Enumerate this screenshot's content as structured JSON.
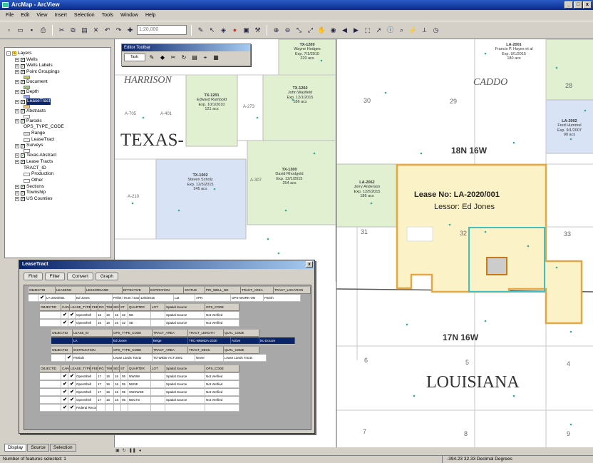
{
  "window": {
    "title": "ArcMap - ArcView"
  },
  "menu": [
    "File",
    "Edit",
    "View",
    "Insert",
    "Selection",
    "Tools",
    "Window",
    "Help"
  ],
  "toolbar": {
    "scale_placeholder": "1:20,000"
  },
  "toc": {
    "items": [
      {
        "label": "Layers",
        "level": 0,
        "pm": "−",
        "cb": false,
        "icon": "layers"
      },
      {
        "label": "Wells",
        "level": 1,
        "pm": "+",
        "cb": true
      },
      {
        "label": "Wells Labels",
        "level": 1,
        "pm": "+",
        "cb": true
      },
      {
        "label": "Point Groupings",
        "level": 1,
        "pm": "+",
        "cb": true
      },
      {
        "label": "",
        "level": 2,
        "swatch": "#cc4"
      },
      {
        "label": "Document",
        "level": 1,
        "pm": "+",
        "cb": true
      },
      {
        "label": "",
        "level": 2,
        "swatch": "#9c6"
      },
      {
        "label": "Depth",
        "level": 1,
        "pm": "+",
        "cb": true
      },
      {
        "label": "",
        "level": 2,
        "swatch": "#9ae"
      },
      {
        "label": "LeaseTract",
        "level": 1,
        "pm": "+",
        "cb": true,
        "selected": true
      },
      {
        "label": "",
        "level": 2,
        "swatch": "#ec8"
      },
      {
        "label": "Abstracts",
        "level": 1,
        "pm": "+",
        "cb": true
      },
      {
        "label": "",
        "level": 2,
        "swatch": "#fff"
      },
      {
        "label": "Parcels",
        "level": 1,
        "pm": "+",
        "cb": true
      },
      {
        "label": "OPS_TYPE_CODE",
        "level": 2
      },
      {
        "label": "Range",
        "level": 2,
        "swatch": "#ddd"
      },
      {
        "label": "LeaseTract",
        "level": 2,
        "swatch": "#eee"
      },
      {
        "label": "Surveys",
        "level": 1,
        "pm": "+",
        "cb": true
      },
      {
        "label": "",
        "level": 2,
        "swatch": "#fff"
      },
      {
        "label": "",
        "level": 2
      },
      {
        "label": "Texas Abstract",
        "level": 1,
        "pm": "+",
        "cb": true
      },
      {
        "label": "Lease Tracts",
        "level": 1,
        "pm": "+",
        "cb": true
      },
      {
        "label": "TRACT_ID",
        "level": 2
      },
      {
        "label": "Production",
        "level": 2,
        "swatch": "#fff"
      },
      {
        "label": "Other",
        "level": 2,
        "swatch": "#fff"
      },
      {
        "label": "Sections",
        "level": 1,
        "pm": "+",
        "cb": true
      },
      {
        "label": "Township",
        "level": 1,
        "pm": "+",
        "cb": true
      },
      {
        "label": "US Counties",
        "level": 1,
        "pm": "+",
        "cb": true
      }
    ],
    "tabs": [
      "Display",
      "Source",
      "Selection"
    ]
  },
  "editor_toolbar": {
    "title": "Editor Toolbar",
    "dropdown": "Task:"
  },
  "map": {
    "county_harrison": "HARRISON",
    "state_texas": "TEXAS-",
    "county_caddo": "CADDO",
    "state_louisiana": "LOUISIANA",
    "township_north": "18N 16W",
    "township_south": "17N 16W",
    "lease_no": "Lease No: LA-2020/001",
    "lessor": "Lessor: Ed Jones",
    "sections": {
      "s30": "30",
      "s29": "29",
      "s28": "28",
      "s31": "31",
      "s32": "32",
      "s33": "33",
      "s6": "6",
      "s5": "5",
      "s4": "4",
      "s7": "7",
      "s8": "8",
      "s9": "9"
    },
    "abstracts": {
      "a1": "A-705",
      "a2": "A-401",
      "a3": "A-273",
      "a4": "A-210",
      "a5": "A-307"
    },
    "tracts": [
      {
        "id": "TX-1200",
        "name": "Wayne Hodges",
        "exp": "Exp. 7/1/2010",
        "acres": "220 acs"
      },
      {
        "id": "TX-1201",
        "name": "Edward Rumbold",
        "exp": "Exp. 10/1/2010",
        "acres": "121 acs"
      },
      {
        "id": "TX-1202",
        "name": "John Wayfield",
        "exp": "Exp. 12/1/2015",
        "acres": "186 acs"
      },
      {
        "id": "TX-1002",
        "name": "Steven Scholz",
        "exp": "Exp. 12/5/2015",
        "acres": "245 acs"
      },
      {
        "id": "TX-1300",
        "name": "David Rhodgold",
        "exp": "Exp. 12/1/2015",
        "acres": "254 acs"
      },
      {
        "id": "LA-2062",
        "name": "Jerry Anderson",
        "exp": "Exp. 12/5/2015",
        "acres": "186 acs"
      },
      {
        "id": "LA-2001",
        "name": "Francis P. Hayes et al",
        "exp": "Exp. 9/1/2015",
        "acres": "180 acs"
      },
      {
        "id": "LA-2002",
        "name": "Fred Hummel",
        "exp": "Exp. 9/1/2007",
        "acres": "90 acs"
      }
    ]
  },
  "attr_window": {
    "title": "LeaseTract",
    "tabs": [
      "Find",
      "Filter",
      "Convert",
      "Graph"
    ],
    "top_header": [
      "OBJECTID",
      "LEASENO",
      "LESSORNAME",
      "EFFECTIVE",
      "EXPIRATION",
      "STATUS",
      "PRI_WELL_NO",
      "TRACT_AREA",
      "TRACT_LOCATION"
    ],
    "row1": [
      "LA-2020/001",
      "Ed Jones",
      "Pellet / Hunt / Sam",
      "12/5/2015",
      "Lat",
      "APN",
      "OPS-WORK-ON",
      "Parish"
    ],
    "sub_header": [
      "OBJECTID",
      "CANC",
      "LEASE_TYPE",
      "FEE",
      "RG",
      "TWP",
      "SEC",
      "ST",
      "QUARTER",
      "LOT",
      "Spatial Source",
      "OPS_CODE"
    ],
    "sub_rows": [
      [
        "OpenShell",
        "16",
        "16",
        "16",
        "32",
        "NE",
        "",
        "Spatial Source",
        "Not Verified"
      ],
      [
        "OpenShell",
        "16",
        "16",
        "16",
        "32",
        "SE",
        "",
        "Spatial Source",
        "Not Verified"
      ]
    ],
    "mid_header": [
      "OBJECTID",
      "LEASE_ID",
      "OPS_TYPE_CODE",
      "TRACT_AREA",
      "TRACT_LENGTH",
      "QUTL_CODE"
    ],
    "sel_row": [
      "LA",
      "Ed Jones",
      "Beige",
      "TRC-WBMDA-2020",
      "Active",
      "No Docum"
    ],
    "mid_header2": [
      "OBJECTID",
      "INSTRUCTION",
      "OPS_TYPE_CODE",
      "TRACT_AREA",
      "TRACT_DESC",
      "QUTL_CODE"
    ],
    "mid_row2": [
      "Partials",
      "Lease Lands Tracts",
      "TO-WIDE-ACT-2001",
      "Never",
      "Lease Lands Tracts"
    ],
    "low_header": [
      "OBJECTID",
      "CANC",
      "LEASE_TYPE",
      "FEE",
      "RG",
      "TWP",
      "SEC",
      "ST",
      "QUARTER",
      "LOT",
      "Spatial Source",
      "OPS_CODE"
    ],
    "low_rows": [
      [
        "OpenShell",
        "17",
        "16",
        "16",
        "05",
        "NWNW",
        "",
        "Spatial Source",
        "Not Verified"
      ],
      [
        "OpenShell",
        "17",
        "16",
        "16",
        "05",
        "NENE",
        "",
        "Spatial Source",
        "Not Verified"
      ],
      [
        "OpenShell",
        "17",
        "16",
        "16",
        "05",
        "SWSWSE",
        "",
        "Spatial Source",
        "Not Verified"
      ],
      [
        "OpenShell",
        "17",
        "16",
        "16",
        "05",
        "NECTS",
        "",
        "Spatial Source",
        "Not Verified"
      ],
      [
        "Federal Records",
        "",
        "",
        "",
        "",
        "",
        "",
        "",
        ""
      ]
    ]
  },
  "status": {
    "left": "Number of features selected: 1",
    "coords": "-394.23  32.33 Decimal Degrees"
  },
  "colors": {
    "texas_tract": "#e0f0d0",
    "blue_tract": "#d8e4f6",
    "lease": "#fcf2c8",
    "lease_border": "#e3a844",
    "selection": "#40c0c0"
  }
}
